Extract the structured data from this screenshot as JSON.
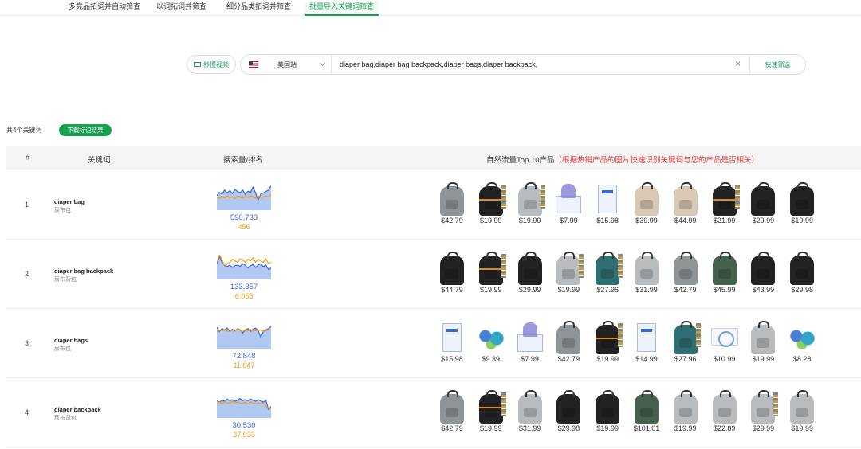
{
  "tabs": [
    {
      "label": "多竞品拓词并自动筛查",
      "active": false
    },
    {
      "label": "以词拓词并筛查",
      "active": false
    },
    {
      "label": "细分品类拓词并筛查",
      "active": false
    },
    {
      "label": "批量导入关键词筛查",
      "active": true
    }
  ],
  "search": {
    "video_label": "秒懂视频",
    "site": "美国站",
    "keywords_value": "diaper bag,diaper bag backpack,diaper bags,diaper backpack,",
    "clear_icon": "close-icon",
    "quick_filter_label": "快速筛选"
  },
  "summary": {
    "count_label": "共4个关键词",
    "download_label": "下载标记结果"
  },
  "table": {
    "headers": {
      "index": "#",
      "keyword": "关键词",
      "volume_rank": "搜索量/排名",
      "top10": "自然流量Top 10产品",
      "top10_note": "（根据热销产品的图片快速识别关键词与您的产品是否相关）"
    },
    "rows": [
      {
        "index": "1",
        "keyword": "diaper bag",
        "keyword_cn": "尿布包",
        "volume": "590,733",
        "rank": "456",
        "trend": [
          0.5,
          0.62,
          0.55,
          0.7,
          0.6,
          0.68,
          0.58,
          0.72,
          0.65,
          0.6,
          0.7,
          0.55,
          0.66,
          0.62,
          0.8,
          0.6,
          0.35,
          0.55,
          0.6,
          0.65,
          0.7,
          0.85
        ],
        "rank_trend": [
          0.45,
          0.4,
          0.48,
          0.42,
          0.5,
          0.44,
          0.46,
          0.4,
          0.5,
          0.45,
          0.42,
          0.48,
          0.44,
          0.5,
          0.46,
          0.42,
          0.48,
          0.44,
          0.46,
          0.5,
          0.45,
          0.55
        ],
        "products": [
          {
            "price": "$42.79",
            "kind": "bag",
            "color": "gray"
          },
          {
            "price": "$19.99",
            "kind": "bag",
            "color": "black",
            "trim": true,
            "strips": true
          },
          {
            "price": "$19.99",
            "kind": "bag",
            "color": "lgray",
            "strips": true
          },
          {
            "price": "$7.99",
            "kind": "box"
          },
          {
            "price": "$15.98",
            "kind": "lbox"
          },
          {
            "price": "$39.99",
            "kind": "bag",
            "color": "beige"
          },
          {
            "price": "$44.99",
            "kind": "bag",
            "color": "beige"
          },
          {
            "price": "$21.99",
            "kind": "bag",
            "color": "black",
            "trim": true,
            "strips": true
          },
          {
            "price": "$29.99",
            "kind": "bag",
            "color": "black"
          },
          {
            "price": "$19.99",
            "kind": "bag",
            "color": "black"
          }
        ]
      },
      {
        "index": "2",
        "keyword": "diaper bag backpack",
        "keyword_cn": "尿布背包",
        "volume": "133,357",
        "rank": "6,058",
        "trend": [
          0.55,
          0.8,
          0.6,
          0.5,
          0.45,
          0.5,
          0.42,
          0.48,
          0.5,
          0.45,
          0.55,
          0.5,
          0.4,
          0.48,
          0.52,
          0.42,
          0.5,
          0.55,
          0.45,
          0.5,
          0.35,
          0.4
        ],
        "rank_trend": [
          0.6,
          0.85,
          0.7,
          0.45,
          0.55,
          0.6,
          0.7,
          0.65,
          0.6,
          0.72,
          0.68,
          0.6,
          0.7,
          0.65,
          0.75,
          0.6,
          0.7,
          0.65,
          0.6,
          0.72,
          0.55,
          0.6
        ],
        "products": [
          {
            "price": "$44.79",
            "kind": "bag",
            "color": "black"
          },
          {
            "price": "$19.99",
            "kind": "bag",
            "color": "black",
            "trim": true,
            "strips": true
          },
          {
            "price": "$29.99",
            "kind": "bag",
            "color": "black"
          },
          {
            "price": "$19.99",
            "kind": "bag",
            "color": "lgray",
            "strips": true
          },
          {
            "price": "$27.96",
            "kind": "bag",
            "color": "teal",
            "strips": true
          },
          {
            "price": "$31.99",
            "kind": "bag",
            "color": "lgray"
          },
          {
            "price": "$42.79",
            "kind": "bag",
            "color": "gray"
          },
          {
            "price": "$45.99",
            "kind": "bag",
            "color": "green"
          },
          {
            "price": "$43.99",
            "kind": "bag",
            "color": "black"
          },
          {
            "price": "$29.98",
            "kind": "bag",
            "color": "black"
          }
        ]
      },
      {
        "index": "3",
        "keyword": "diaper bags",
        "keyword_cn": "尿布包",
        "volume": "72,848",
        "rank": "11,647",
        "trend": [
          0.75,
          0.6,
          0.7,
          0.65,
          0.72,
          0.6,
          0.68,
          0.62,
          0.7,
          0.66,
          0.55,
          0.65,
          0.7,
          0.6,
          0.68,
          0.72,
          0.64,
          0.4,
          0.6,
          0.66,
          0.7,
          0.78
        ],
        "rank_trend": [
          0.6,
          0.65,
          0.62,
          0.68,
          0.6,
          0.66,
          0.62,
          0.6,
          0.68,
          0.64,
          0.6,
          0.66,
          0.62,
          0.68,
          0.6,
          0.64,
          0.62,
          0.66,
          0.6,
          0.62,
          0.66,
          0.64
        ],
        "products": [
          {
            "price": "$15.98",
            "kind": "lbox"
          },
          {
            "price": "$9.39",
            "kind": "rolls"
          },
          {
            "price": "$7.99",
            "kind": "box"
          },
          {
            "price": "$42.79",
            "kind": "bag",
            "color": "gray"
          },
          {
            "price": "$19.99",
            "kind": "bag",
            "color": "black",
            "trim": true,
            "strips": true
          },
          {
            "price": "$14.99",
            "kind": "lbox"
          },
          {
            "price": "$27.96",
            "kind": "bag",
            "color": "teal",
            "strips": true
          },
          {
            "price": "$10.99",
            "kind": "disc"
          },
          {
            "price": "$19.99",
            "kind": "bag",
            "color": "lgray"
          },
          {
            "price": "$8.28",
            "kind": "rolls"
          }
        ]
      },
      {
        "index": "4",
        "keyword": "diaper backpack",
        "keyword_cn": "尿布背包",
        "volume": "30,530",
        "rank": "37,033",
        "trend": [
          0.6,
          0.55,
          0.62,
          0.58,
          0.66,
          0.6,
          0.64,
          0.58,
          0.62,
          0.68,
          0.6,
          0.64,
          0.6,
          0.66,
          0.62,
          0.58,
          0.64,
          0.6,
          0.55,
          0.62,
          0.3,
          0.4
        ],
        "rank_trend": [
          0.5,
          0.55,
          0.48,
          0.56,
          0.52,
          0.5,
          0.58,
          0.5,
          0.56,
          0.52,
          0.5,
          0.55,
          0.48,
          0.56,
          0.52,
          0.5,
          0.54,
          0.5,
          0.52,
          0.4,
          0.35,
          0.3
        ],
        "products": [
          {
            "price": "$42.79",
            "kind": "bag",
            "color": "gray"
          },
          {
            "price": "$19.99",
            "kind": "bag",
            "color": "black",
            "trim": true,
            "strips": true
          },
          {
            "price": "$31.99",
            "kind": "bag",
            "color": "lgray"
          },
          {
            "price": "$29.98",
            "kind": "bag",
            "color": "black"
          },
          {
            "price": "$19.99",
            "kind": "bag",
            "color": "black"
          },
          {
            "price": "$101.01",
            "kind": "bag",
            "color": "green"
          },
          {
            "price": "$19.99",
            "kind": "bag",
            "color": "lgray"
          },
          {
            "price": "$22.89",
            "kind": "bag",
            "color": "lgray"
          },
          {
            "price": "$29.99",
            "kind": "bag",
            "color": "lgray",
            "strips": true
          },
          {
            "price": "$19.99",
            "kind": "bag",
            "color": "lgray"
          }
        ]
      }
    ]
  },
  "colors": {
    "accent": "#1aa053",
    "volume": "#3a66e0",
    "rank": "#f39c12",
    "note_red": "#e53935"
  }
}
